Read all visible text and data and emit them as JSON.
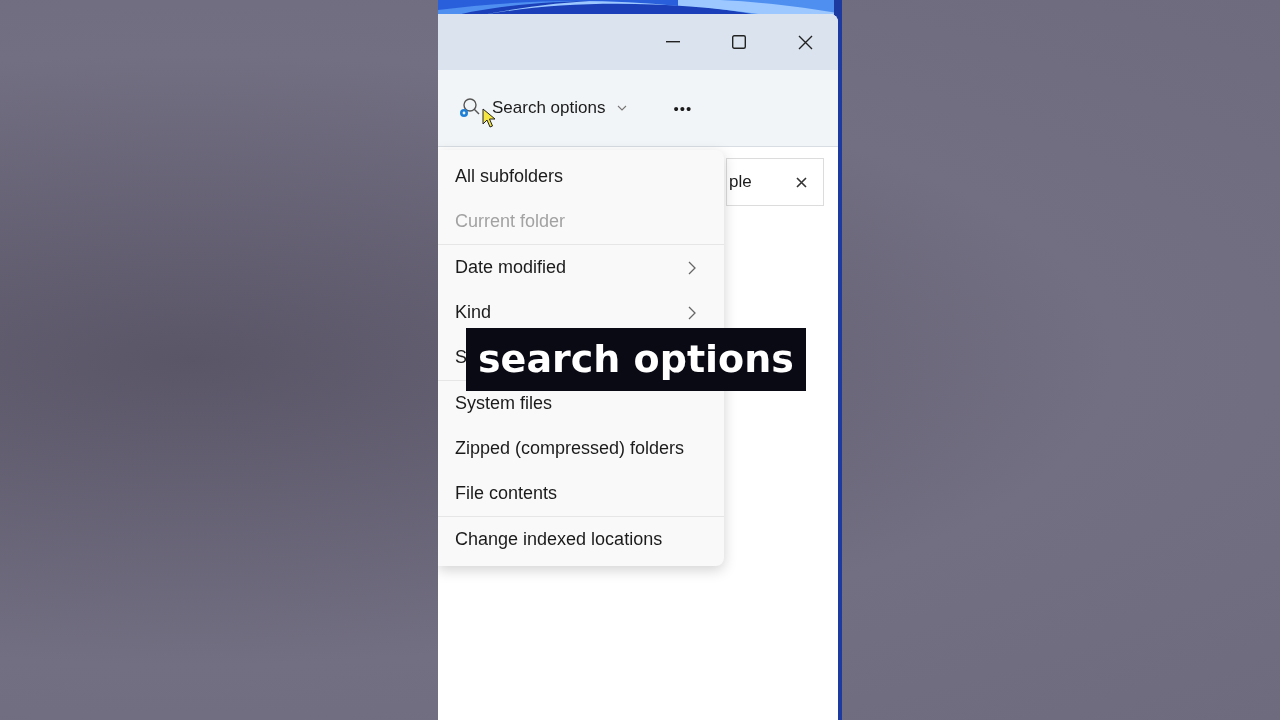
{
  "toolbar": {
    "search_options": {
      "label": "Search options"
    },
    "more": "•••"
  },
  "search_box": {
    "value": "ple"
  },
  "menu": {
    "groups": [
      {
        "items": [
          {
            "label": "All subfolders",
            "kind": "option",
            "disabled": false
          },
          {
            "label": "Current folder",
            "kind": "option",
            "disabled": true
          }
        ]
      },
      {
        "items": [
          {
            "label": "Date modified",
            "kind": "submenu",
            "disabled": false
          },
          {
            "label": "Kind",
            "kind": "submenu",
            "disabled": false
          },
          {
            "label": "S",
            "kind": "option",
            "disabled": false
          }
        ]
      },
      {
        "items": [
          {
            "label": "System files",
            "kind": "option",
            "disabled": false
          },
          {
            "label": "Zipped (compressed) folders",
            "kind": "option",
            "disabled": false
          },
          {
            "label": "File contents",
            "kind": "option",
            "disabled": false
          }
        ]
      },
      {
        "items": [
          {
            "label": "Change indexed locations",
            "kind": "option",
            "disabled": false
          }
        ]
      }
    ]
  },
  "caption": "search options"
}
